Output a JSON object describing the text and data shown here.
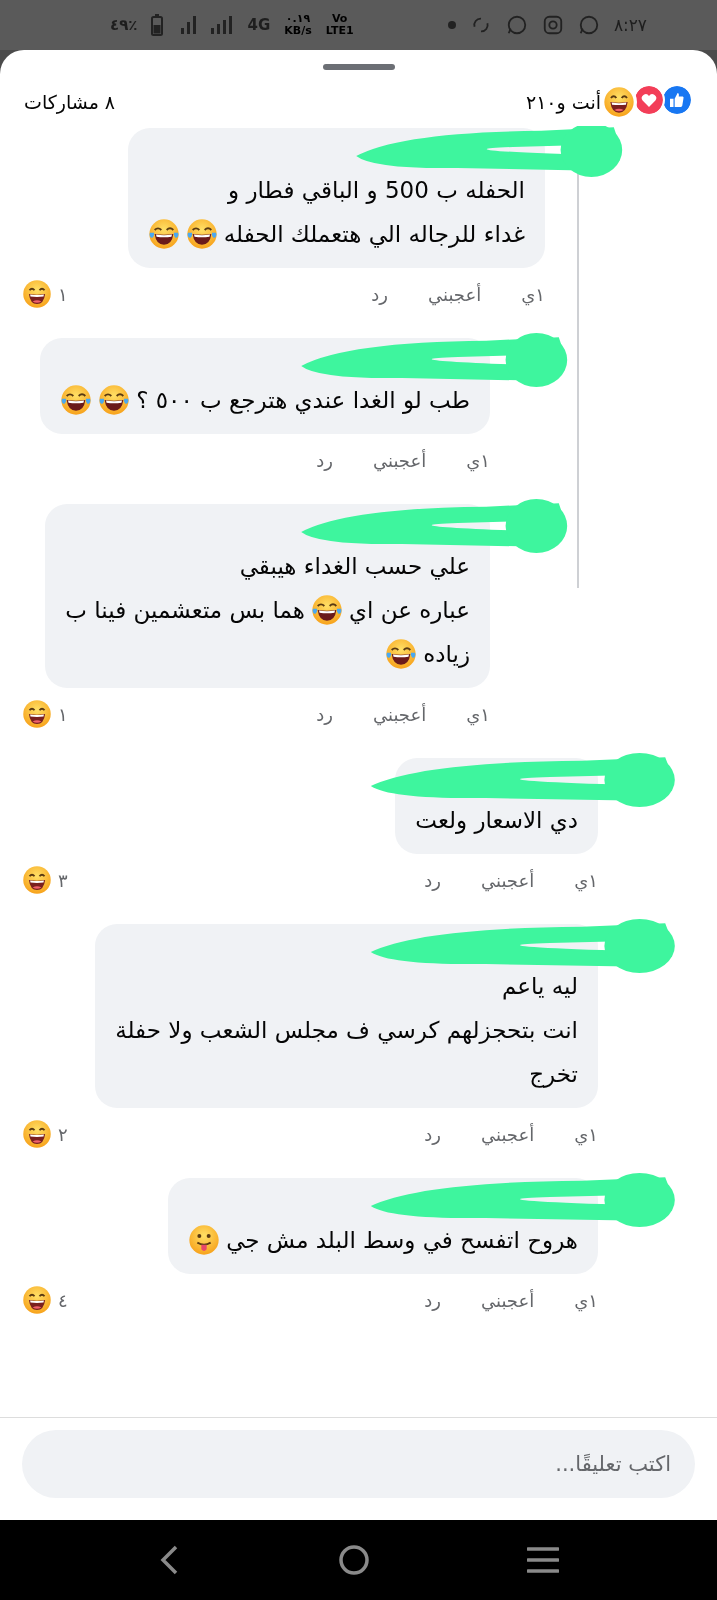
{
  "status_bar": {
    "time": "٨:٢٧",
    "battery": "٪٤٩",
    "network": "4G",
    "speed_value": "٠.١٩",
    "speed_unit": "KB/s",
    "volte_top": "Vo",
    "volte_bottom": "LTE1"
  },
  "header": {
    "reactions_text": "أنت و٢١٠",
    "shares": "٨ مشاركات"
  },
  "thread": [
    {
      "lines": [
        [
          {
            "kind": "text",
            "text": "الحفله ب 500 و الباقي فطار و"
          }
        ],
        [
          {
            "kind": "text",
            "text": "غداء للرجاله الي هتعملك الحفله"
          },
          {
            "kind": "laughing-emoji"
          },
          {
            "kind": "laughing-emoji"
          }
        ]
      ],
      "time": "١ي",
      "like": "أعجبني",
      "reply": "رد",
      "reaction_count": "١",
      "replies": [
        {
          "lines": [
            [
              {
                "kind": "text",
                "text": "طب لو الغدا عندي هترجع ب ٥٠٠ ؟"
              },
              {
                "kind": "laughing-emoji"
              },
              {
                "kind": "laughing-emoji"
              }
            ]
          ],
          "time": "١ي",
          "like": "أعجبني",
          "reply": "رد"
        },
        {
          "lines": [
            [
              {
                "kind": "text",
                "text": "علي حسب الغداء هيبقي"
              }
            ],
            [
              {
                "kind": "text",
                "text": "عباره عن اي"
              },
              {
                "kind": "laughing-emoji"
              },
              {
                "kind": "text",
                "text": "هما بس متعشمين فينا ب"
              }
            ],
            [
              {
                "kind": "text",
                "text": "زياده"
              },
              {
                "kind": "laughing-emoji"
              }
            ]
          ],
          "time": "١ي",
          "like": "أعجبني",
          "reply": "رد",
          "reaction_count": "١"
        }
      ]
    }
  ],
  "comments": [
    {
      "lines": [
        [
          {
            "kind": "text",
            "text": "دي الاسعار ولعت"
          }
        ]
      ],
      "time": "١ي",
      "like": "أعجبني",
      "reply": "رد",
      "reaction_count": "٣"
    },
    {
      "lines": [
        [
          {
            "kind": "text",
            "text": "ليه ياعم"
          }
        ],
        [
          {
            "kind": "text",
            "text": "انت بتحجزلهم كرسي ف مجلس الشعب ولا حفلة"
          }
        ],
        [
          {
            "kind": "text",
            "text": "تخرج"
          }
        ]
      ],
      "time": "١ي",
      "like": "أعجبني",
      "reply": "رد",
      "reaction_count": "٢"
    },
    {
      "lines": [
        [
          {
            "kind": "text",
            "text": "هروح اتفسح في وسط البلد مش جي"
          },
          {
            "kind": "tongue-emoji"
          }
        ]
      ],
      "time": "١ي",
      "like": "أعجبني",
      "reply": "رد",
      "reaction_count": "٤"
    }
  ],
  "composer": {
    "placeholder": "اكتب تعليقًا..."
  }
}
